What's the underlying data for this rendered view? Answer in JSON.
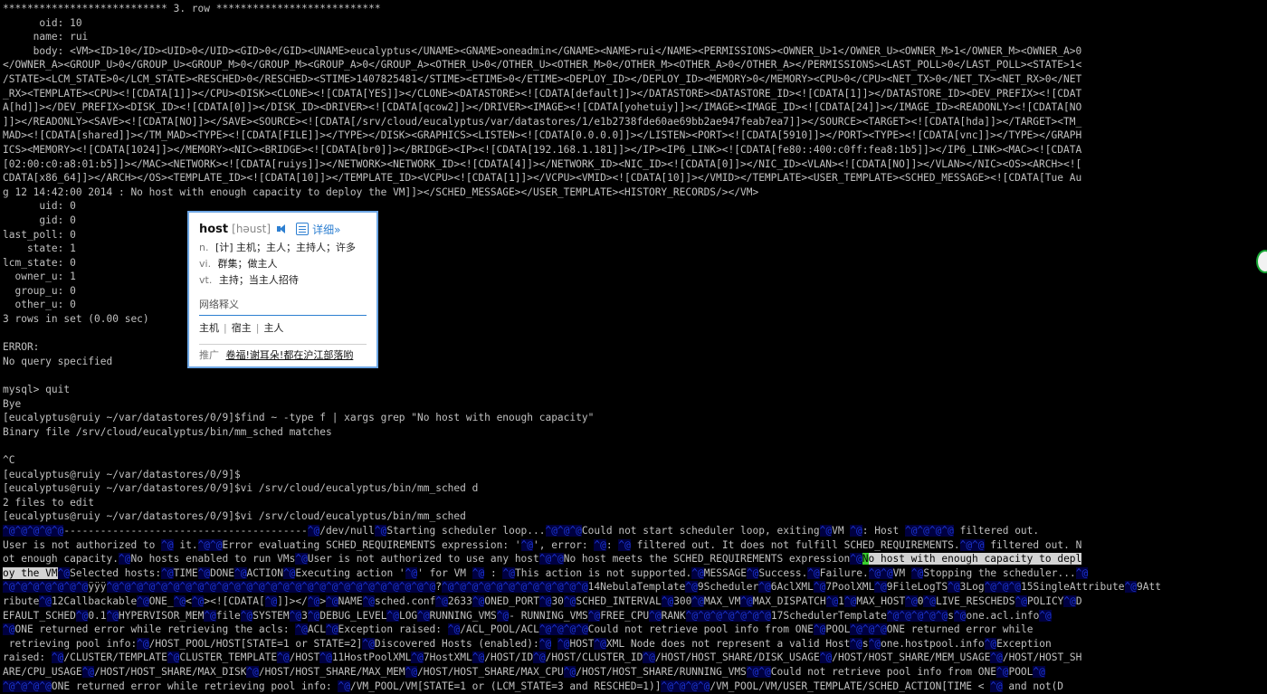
{
  "terminal": {
    "lines": [
      [
        {
          "t": "*************************** 3. row ***************************"
        }
      ],
      [
        {
          "t": "      oid: 10"
        }
      ],
      [
        {
          "t": "     name: rui"
        }
      ],
      [
        {
          "t": "     body: <VM><ID>10</ID><UID>0</UID><GID>0</GID><UNAME>eucalyptus</UNAME><GNAME>oneadmin</GNAME><NAME>rui</NAME><PERMISSIONS><OWNER_U>1</OWNER_U><OWNER_M>1</OWNER_M><OWNER_A>0"
        }
      ],
      [
        {
          "t": "</OWNER_A><GROUP_U>0</GROUP_U><GROUP_M>0</GROUP_M><GROUP_A>0</GROUP_A><OTHER_U>0</OTHER_U><OTHER_M>0</OTHER_M><OTHER_A>0</OTHER_A></PERMISSIONS><LAST_POLL>0</LAST_POLL><STATE>1<"
        }
      ],
      [
        {
          "t": "/STATE><LCM_STATE>0</LCM_STATE><RESCHED>0</RESCHED><STIME>1407825481</STIME><ETIME>0</ETIME><DEPLOY_ID></DEPLOY_ID><MEMORY>0</MEMORY><CPU>0</CPU><NET_TX>0</NET_TX><NET_RX>0</NET"
        }
      ],
      [
        {
          "t": "_RX><TEMPLATE><CPU><![CDATA[1]]></CPU><DISK><CLONE><![CDATA[YES]]></CLONE><DATASTORE><![CDATA[default]]></DATASTORE><DATASTORE_ID><![CDATA[1]]></DATASTORE_ID><DEV_PREFIX><![CDAT"
        }
      ],
      [
        {
          "t": "A[hd]]></DEV_PREFIX><DISK_ID><![CDATA[0]]></DISK_ID><DRIVER><![CDATA[qcow2]]></DRIVER><IMAGE><![CDATA[yohetuiy]]></IMAGE><IMAGE_ID><![CDATA[24]]></IMAGE_ID><READONLY><![CDATA[NO"
        }
      ],
      [
        {
          "t": "]]></READONLY><SAVE><![CDATA[NO]]></SAVE><SOURCE><![CDATA[/srv/cloud/eucalyptus/var/datastores/1/e1b2738fde60ae69bb2ae947feab7ea7]]></SOURCE><TARGET><![CDATA[hda]]></TARGET><TM_"
        }
      ],
      [
        {
          "t": "MAD><![CDATA[shared]]></TM_MAD><TYPE><![CDATA[FILE]]></TYPE></DISK><GRAPHICS><LISTEN><![CDATA[0.0.0.0]]></LISTEN><PORT><![CDATA[5910]]></PORT><TYPE><![CDATA[vnc]]></TYPE></GRAPH"
        }
      ],
      [
        {
          "t": "ICS><MEMORY><![CDATA[1024]]></MEMORY><NIC><BRIDGE><![CDATA[br0]]></BRIDGE><IP><![CDATA[192.168.1.181]]></IP><IP6_LINK><![CDATA[fe80::400:c0ff:fea8:1b5]]></IP6_LINK><MAC><![CDATA"
        }
      ],
      [
        {
          "t": "[02:00:c0:a8:01:b5]]></MAC><NETWORK><![CDATA[ruiys]]></NETWORK><NETWORK_ID><![CDATA[4]]></NETWORK_ID><NIC_ID><![CDATA[0]]></NIC_ID><VLAN><![CDATA[NO]]></VLAN></NIC><OS><ARCH><!["
        }
      ],
      [
        {
          "t": "CDATA[x86_64]]></ARCH></OS><TEMPLATE_ID><![CDATA[10]]></TEMPLATE_ID><VCPU><![CDATA[1]]></VCPU><VMID><![CDATA[10]]></VMID></TEMPLATE><USER_TEMPLATE><SCHED_MESSAGE><![CDATA[Tue Au"
        }
      ],
      [
        {
          "t": "g 12 14:42:00 2014 : No host with enough capacity to deploy the VM]]></SCHED_MESSAGE></USER_TEMPLATE><HISTORY_RECORDS/></VM>"
        }
      ],
      [
        {
          "t": "      uid: 0"
        }
      ],
      [
        {
          "t": "      gid: 0"
        }
      ],
      [
        {
          "t": "last_poll: 0"
        }
      ],
      [
        {
          "t": "    state: 1"
        }
      ],
      [
        {
          "t": "lcm_state: 0"
        }
      ],
      [
        {
          "t": "  owner_u: 1"
        }
      ],
      [
        {
          "t": "  group_u: 0"
        }
      ],
      [
        {
          "t": "  other_u: 0"
        }
      ],
      [
        {
          "t": "3 rows in set (0.00 sec)"
        }
      ],
      [
        {
          "t": ""
        }
      ],
      [
        {
          "t": "ERROR:"
        }
      ],
      [
        {
          "t": "No query specified"
        }
      ],
      [
        {
          "t": ""
        }
      ],
      [
        {
          "t": "mysql> quit"
        }
      ],
      [
        {
          "t": "Bye"
        }
      ],
      [
        {
          "t": "[eucalyptus@ruiy ~/var/datastores/0/9]$find ~ -type f | xargs grep \"No host with enough capacity\""
        }
      ],
      [
        {
          "t": "Binary file /srv/cloud/eucalyptus/bin/mm_sched matches"
        }
      ],
      [
        {
          "t": ""
        }
      ],
      [
        {
          "t": "^C"
        }
      ],
      [
        {
          "t": "[eucalyptus@ruiy ~/var/datastores/0/9]$"
        }
      ],
      [
        {
          "t": "[eucalyptus@ruiy ~/var/datastores/0/9]$vi /srv/cloud/eucalyptus/bin/mm_sched d"
        }
      ],
      [
        {
          "t": "2 files to edit"
        }
      ],
      [
        {
          "t": "[eucalyptus@ruiy ~/var/datastores/0/9]$vi /srv/cloud/eucalyptus/bin/mm_sched"
        }
      ],
      [
        {
          "t": "^@^@^@^@^@",
          "c": "ctl"
        },
        {
          "t": "----------------------------------------"
        },
        {
          "t": "^@",
          "c": "ctl"
        },
        {
          "t": "/dev/null"
        },
        {
          "t": "^@",
          "c": "ctl"
        },
        {
          "t": "Starting scheduler loop..."
        },
        {
          "t": "^@^@^@",
          "c": "ctl"
        },
        {
          "t": "Could not start scheduler loop, exiting"
        },
        {
          "t": "^@",
          "c": "ctl"
        },
        {
          "t": "VM "
        },
        {
          "t": "^@",
          "c": "ctl"
        },
        {
          "t": ": Host "
        },
        {
          "t": "^@^@^@^@",
          "c": "ctl"
        },
        {
          "t": " filtered out."
        }
      ],
      [
        {
          "t": "User is not authorized to "
        },
        {
          "t": "^@",
          "c": "ctl"
        },
        {
          "t": " it."
        },
        {
          "t": "^@^@",
          "c": "ctl"
        },
        {
          "t": "Error evaluating SCHED_REQUIREMENTS expression: '"
        },
        {
          "t": "^@",
          "c": "ctl"
        },
        {
          "t": "', error: "
        },
        {
          "t": "^@",
          "c": "ctl"
        },
        {
          "t": ": "
        },
        {
          "t": "^@",
          "c": "ctl"
        },
        {
          "t": " filtered out. It does not fulfill SCHED_REQUIREMENTS."
        },
        {
          "t": "^@^@",
          "c": "ctl"
        },
        {
          "t": " filtered out. N"
        }
      ],
      [
        {
          "t": "ot enough capacity."
        },
        {
          "t": "^@",
          "c": "ctl"
        },
        {
          "t": "No hosts enabled to run VMs"
        },
        {
          "t": "^@",
          "c": "ctl"
        },
        {
          "t": "User is not authorized to use any host"
        },
        {
          "t": "^@^@",
          "c": "ctl"
        },
        {
          "t": "No host meets the SCHED_REQUIREMENTS expression"
        },
        {
          "t": "^@",
          "c": "ctl"
        },
        {
          "t": "N",
          "c": "cursor"
        },
        {
          "t": "o host with enough capacity to depl",
          "c": "sel"
        }
      ],
      [
        {
          "t": "oy the VM",
          "c": "sel"
        },
        {
          "t": "^@",
          "c": "ctl"
        },
        {
          "t": "Selected hosts:"
        },
        {
          "t": "^@",
          "c": "ctl"
        },
        {
          "t": "TIME"
        },
        {
          "t": "^@",
          "c": "ctl"
        },
        {
          "t": "DONE"
        },
        {
          "t": "^@",
          "c": "ctl"
        },
        {
          "t": "ACTION"
        },
        {
          "t": "^@",
          "c": "ctl"
        },
        {
          "t": "Executing action '"
        },
        {
          "t": "^@",
          "c": "ctl"
        },
        {
          "t": "' for VM "
        },
        {
          "t": "^@",
          "c": "ctl"
        },
        {
          "t": " : "
        },
        {
          "t": "^@",
          "c": "ctl"
        },
        {
          "t": "This action is not supported."
        },
        {
          "t": "^@",
          "c": "ctl"
        },
        {
          "t": "MESSAGE"
        },
        {
          "t": "^@",
          "c": "ctl"
        },
        {
          "t": "Success."
        },
        {
          "t": "^@",
          "c": "ctl"
        },
        {
          "t": "Failure."
        },
        {
          "t": "^@^@",
          "c": "ctl"
        },
        {
          "t": "VM "
        },
        {
          "t": "^@",
          "c": "ctl"
        },
        {
          "t": "Stopping the scheduler..."
        },
        {
          "t": "^@",
          "c": "ctl"
        }
      ],
      [
        {
          "t": "^@^@^@^@^@^@^@",
          "c": "ctl"
        },
        {
          "t": "ÿÿÿ"
        },
        {
          "t": "^@^@^@^@^@^@^@^@^@^@^@^@^@^@^@^@^@^@^@^@^@^@^@^@^@^@^@",
          "c": "ctl"
        },
        {
          "t": "?"
        },
        {
          "t": "^@^@^@^@^@^@^@^@^@^@^@^@",
          "c": "ctl"
        },
        {
          "t": "14NebulaTemplate"
        },
        {
          "t": "^@",
          "c": "ctl"
        },
        {
          "t": "9Scheduler"
        },
        {
          "t": "^@",
          "c": "ctl"
        },
        {
          "t": "6AclXML"
        },
        {
          "t": "^@",
          "c": "ctl"
        },
        {
          "t": "7PoolXML"
        },
        {
          "t": "^@",
          "c": "ctl"
        },
        {
          "t": "9FileLogTS"
        },
        {
          "t": "^@",
          "c": "ctl"
        },
        {
          "t": "3Log"
        },
        {
          "t": "^@^@^@",
          "c": "ctl"
        },
        {
          "t": "15SingleAttribute"
        },
        {
          "t": "^@",
          "c": "ctl"
        },
        {
          "t": "9Att"
        }
      ],
      [
        {
          "t": "ribute"
        },
        {
          "t": "^@",
          "c": "ctl"
        },
        {
          "t": "12Callbackable"
        },
        {
          "t": "^@",
          "c": "ctl"
        },
        {
          "t": "ONE_"
        },
        {
          "t": "^@",
          "c": "ctl"
        },
        {
          "t": "<"
        },
        {
          "t": "^@",
          "c": "ctl"
        },
        {
          "t": "><![CDATA["
        },
        {
          "t": "^@",
          "c": "ctl"
        },
        {
          "t": "]]></"
        },
        {
          "t": "^@",
          "c": "ctl"
        },
        {
          "t": ">"
        },
        {
          "t": "^@",
          "c": "ctl"
        },
        {
          "t": "NAME"
        },
        {
          "t": "^@",
          "c": "ctl"
        },
        {
          "t": "sched.conf"
        },
        {
          "t": "^@",
          "c": "ctl"
        },
        {
          "t": "2633"
        },
        {
          "t": "^@",
          "c": "ctl"
        },
        {
          "t": "ONED_PORT"
        },
        {
          "t": "^@",
          "c": "ctl"
        },
        {
          "t": "30"
        },
        {
          "t": "^@",
          "c": "ctl"
        },
        {
          "t": "SCHED_INTERVAL"
        },
        {
          "t": "^@",
          "c": "ctl"
        },
        {
          "t": "300"
        },
        {
          "t": "^@",
          "c": "ctl"
        },
        {
          "t": "MAX_VM"
        },
        {
          "t": "^@",
          "c": "ctl"
        },
        {
          "t": "MAX_DISPATCH"
        },
        {
          "t": "^@",
          "c": "ctl"
        },
        {
          "t": "1"
        },
        {
          "t": "^@",
          "c": "ctl"
        },
        {
          "t": "MAX_HOST"
        },
        {
          "t": "^@",
          "c": "ctl"
        },
        {
          "t": "0"
        },
        {
          "t": "^@",
          "c": "ctl"
        },
        {
          "t": "LIVE_RESCHEDS"
        },
        {
          "t": "^@",
          "c": "ctl"
        },
        {
          "t": "POLICY"
        },
        {
          "t": "^@",
          "c": "ctl"
        },
        {
          "t": "D"
        }
      ],
      [
        {
          "t": "EFAULT_SCHED"
        },
        {
          "t": "^@",
          "c": "ctl"
        },
        {
          "t": "0.1"
        },
        {
          "t": "^@",
          "c": "ctl"
        },
        {
          "t": "HYPERVISOR_MEM"
        },
        {
          "t": "^@",
          "c": "ctl"
        },
        {
          "t": "file"
        },
        {
          "t": "^@",
          "c": "ctl"
        },
        {
          "t": "SYSTEM"
        },
        {
          "t": "^@",
          "c": "ctl"
        },
        {
          "t": "3"
        },
        {
          "t": "^@",
          "c": "ctl"
        },
        {
          "t": "DEBUG_LEVEL"
        },
        {
          "t": "^@",
          "c": "ctl"
        },
        {
          "t": "LOG"
        },
        {
          "t": "^@",
          "c": "ctl"
        },
        {
          "t": "RUNNING_VMS"
        },
        {
          "t": "^@",
          "c": "ctl"
        },
        {
          "t": "- RUNNING_VMS"
        },
        {
          "t": "^@",
          "c": "ctl"
        },
        {
          "t": "FREE_CPU"
        },
        {
          "t": "^@",
          "c": "ctl"
        },
        {
          "t": "RANK"
        },
        {
          "t": "^@^@^@^@^@^@^@",
          "c": "ctl"
        },
        {
          "t": "17SchedulerTemplate"
        },
        {
          "t": "^@^@^@^@^@",
          "c": "ctl"
        },
        {
          "t": "s"
        },
        {
          "t": "^@",
          "c": "ctl"
        },
        {
          "t": "one.acl.info"
        },
        {
          "t": "^@",
          "c": "ctl"
        }
      ],
      [
        {
          "t": "^@",
          "c": "ctl"
        },
        {
          "t": "ONE returned error while retrieving the acls: "
        },
        {
          "t": "^@",
          "c": "ctl"
        },
        {
          "t": "ACL"
        },
        {
          "t": "^@",
          "c": "ctl"
        },
        {
          "t": "Exception raised: "
        },
        {
          "t": "^@",
          "c": "ctl"
        },
        {
          "t": "/ACL_POOL/ACL"
        },
        {
          "t": "^@^@^@^@",
          "c": "ctl"
        },
        {
          "t": "Could not retrieve pool info from ONE"
        },
        {
          "t": "^@",
          "c": "ctl"
        },
        {
          "t": "POOL"
        },
        {
          "t": "^@^@^@",
          "c": "ctl"
        },
        {
          "t": "ONE returned error while"
        }
      ],
      [
        {
          "t": " retrieving pool info:"
        },
        {
          "t": "^@",
          "c": "ctl"
        },
        {
          "t": "/HOST_POOL/HOST[STATE=1 or STATE=2]"
        },
        {
          "t": "^@",
          "c": "ctl"
        },
        {
          "t": "Discovered Hosts (enabled):"
        },
        {
          "t": "^@",
          "c": "ctl"
        },
        {
          "t": " "
        },
        {
          "t": "^@",
          "c": "ctl"
        },
        {
          "t": "HOST"
        },
        {
          "t": "^@",
          "c": "ctl"
        },
        {
          "t": "XML Node does not represent a valid Host"
        },
        {
          "t": "^@",
          "c": "ctl"
        },
        {
          "t": "s"
        },
        {
          "t": "^@",
          "c": "ctl"
        },
        {
          "t": "one.hostpool.info"
        },
        {
          "t": "^@",
          "c": "ctl"
        },
        {
          "t": "Exception"
        }
      ],
      [
        {
          "t": "raised: "
        },
        {
          "t": "^@",
          "c": "ctl"
        },
        {
          "t": "/CLUSTER/TEMPLATE"
        },
        {
          "t": "^@",
          "c": "ctl"
        },
        {
          "t": "CLUSTER_TEMPLATE"
        },
        {
          "t": "^@",
          "c": "ctl"
        },
        {
          "t": "/HOST"
        },
        {
          "t": "^@",
          "c": "ctl"
        },
        {
          "t": "11HostPoolXML"
        },
        {
          "t": "^@",
          "c": "ctl"
        },
        {
          "t": "7HostXML"
        },
        {
          "t": "^@",
          "c": "ctl"
        },
        {
          "t": "/HOST/ID"
        },
        {
          "t": "^@",
          "c": "ctl"
        },
        {
          "t": "/HOST/CLUSTER_ID"
        },
        {
          "t": "^@",
          "c": "ctl"
        },
        {
          "t": "/HOST/HOST_SHARE/DISK_USAGE"
        },
        {
          "t": "^@",
          "c": "ctl"
        },
        {
          "t": "/HOST/HOST_SHARE/MEM_USAGE"
        },
        {
          "t": "^@",
          "c": "ctl"
        },
        {
          "t": "/HOST/HOST_SH"
        }
      ],
      [
        {
          "t": "ARE/CPU_USAGE"
        },
        {
          "t": "^@",
          "c": "ctl"
        },
        {
          "t": "/HOST/HOST_SHARE/MAX_DISK"
        },
        {
          "t": "^@",
          "c": "ctl"
        },
        {
          "t": "/HOST/HOST_SHARE/MAX_MEM"
        },
        {
          "t": "^@",
          "c": "ctl"
        },
        {
          "t": "/HOST/HOST_SHARE/MAX_CPU"
        },
        {
          "t": "^@",
          "c": "ctl"
        },
        {
          "t": "/HOST/HOST_SHARE/RUNNING_VMS"
        },
        {
          "t": "^@^@",
          "c": "ctl"
        },
        {
          "t": "Could not retrieve pool info from ONE"
        },
        {
          "t": "^@",
          "c": "ctl"
        },
        {
          "t": "POOL"
        },
        {
          "t": "^@",
          "c": "ctl"
        }
      ],
      [
        {
          "t": "^@^@^@^@",
          "c": "ctl"
        },
        {
          "t": "ONE returned error while retrieving pool info: "
        },
        {
          "t": "^@",
          "c": "ctl"
        },
        {
          "t": "/VM_POOL/VM[STATE=1 or (LCM_STATE=3 and RESCHED=1)]"
        },
        {
          "t": "^@^@^@^@",
          "c": "ctl"
        },
        {
          "t": "/VM_POOL/VM/USER_TEMPLATE/SCHED_ACTION[TIME < "
        },
        {
          "t": "^@",
          "c": "ctl"
        },
        {
          "t": " and not(D"
        }
      ]
    ]
  },
  "dict_popup": {
    "word": "host",
    "phonetic": "[həust]",
    "detail_link": "详细»",
    "defs": [
      {
        "pos": "n.",
        "text": "[计] 主机；主人；主持人；许多"
      },
      {
        "pos": "vi.",
        "text": "群集；做主人"
      },
      {
        "pos": "vt.",
        "text": "主持；当主人招待"
      }
    ],
    "web_title": "网络释义",
    "web_items": [
      "主机",
      "宿主",
      "主人"
    ],
    "ad_label": "推广",
    "ad_text": "卷福!谢耳朵!都在沪江部落哟"
  }
}
